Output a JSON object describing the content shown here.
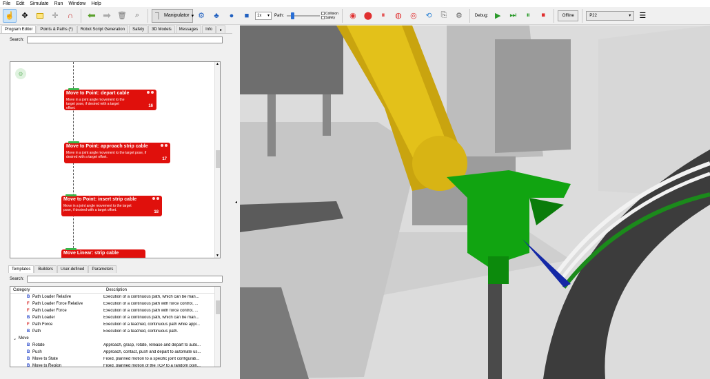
{
  "menu": [
    "File",
    "Edit",
    "Simulate",
    "Run",
    "Window",
    "Help"
  ],
  "toolbar": {
    "manipulator": "Manipulator",
    "speed": "1x",
    "path_label": "Path:",
    "path_progress": 0.15,
    "collision": "Collision",
    "safety": "Safety",
    "debug": "Debug:",
    "offline": "Offline",
    "program": "P22"
  },
  "tabs": [
    "Program Editor",
    "Points & Paths (*)",
    "Robot Script Generation",
    "Safety",
    "3D Models",
    "Messages",
    "Info"
  ],
  "search_label": "Search:",
  "blocks": [
    {
      "title": "Move to Point: depart cable",
      "desc": "Move in a joint angle movement to the target pose, if desired with a target offset.",
      "num": "16"
    },
    {
      "title": "Move to Point: approach strip cable",
      "desc": "Move in a joint angle movement to the target pose, if desired with a target offset.",
      "num": "17"
    },
    {
      "title": "Move to Point: insert strip cable",
      "desc": "Move in a joint angle movement to the target pose, if desired with a target offset.",
      "num": "18"
    },
    {
      "title": "Move Linear: strip cable"
    }
  ],
  "bottom_tabs": [
    "Templates",
    "Builders",
    "User-defined",
    "Parameters"
  ],
  "tree_header": {
    "category": "Category",
    "description": "Description"
  },
  "tree_rows": [
    {
      "name": "Path Loader Relative",
      "desc": "Execution of a continuous path, which can be man...",
      "icon": "B"
    },
    {
      "name": "Path Loader Force Relative",
      "desc": "Execution of a continuous path with force control, ...",
      "icon": "F"
    },
    {
      "name": "Path Loader Force",
      "desc": "Execution of a continuous path with force control, ...",
      "icon": "F"
    },
    {
      "name": "Path Loader",
      "desc": "Execution of a continuous path, which can be man...",
      "icon": "B"
    },
    {
      "name": "Path Force",
      "desc": "Execution of a teached, continuous path while appl...",
      "icon": "F"
    },
    {
      "name": "Path",
      "desc": "Execution of a teached, continuous path.",
      "icon": "B"
    }
  ],
  "tree_group": "Move",
  "tree_rows2": [
    {
      "name": "Rotate",
      "desc": "Approach, grasp, rotate, release and depart to auto...",
      "icon": "B"
    },
    {
      "name": "Push",
      "desc": "Approach, contact, push and depart to automate us...",
      "icon": "B"
    },
    {
      "name": "Move to State",
      "desc": "Fixed, planned motion to a specific joint configurati...",
      "icon": "B"
    },
    {
      "name": "Move to Region",
      "desc": "Fixed, planned motion of the TCP to a random poin...",
      "icon": "B"
    }
  ]
}
